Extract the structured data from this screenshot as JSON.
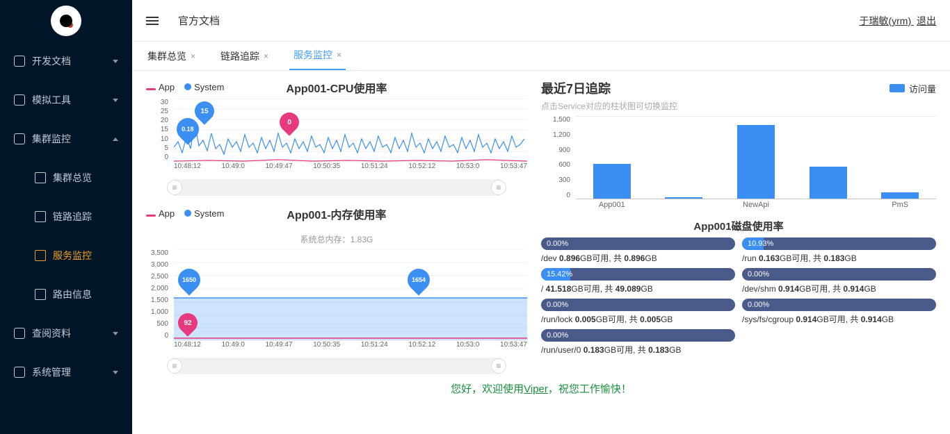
{
  "sidebar": {
    "items": [
      {
        "label": "开发文档",
        "chev": "down"
      },
      {
        "label": "模拟工具",
        "chev": "down"
      },
      {
        "label": "集群监控",
        "chev": "up"
      },
      {
        "label": "集群总览",
        "child": true
      },
      {
        "label": "链路追踪",
        "child": true
      },
      {
        "label": "服务监控",
        "child": true,
        "active": true
      },
      {
        "label": "路由信息",
        "child": true
      },
      {
        "label": "查阅资料",
        "chev": "down"
      },
      {
        "label": "系统管理",
        "chev": "down"
      }
    ]
  },
  "header": {
    "breadcrumb": "官方文档",
    "user": "于瑞敏(yrm) ",
    "logout": "退出"
  },
  "tabs": [
    {
      "label": "集群总览"
    },
    {
      "label": "链路追踪"
    },
    {
      "label": "服务监控",
      "active": true
    }
  ],
  "legend": {
    "app": "App",
    "system": "System"
  },
  "cpu": {
    "title": "App001-CPU使用率",
    "pin_app": "0",
    "pin_app_x": 192,
    "pin_app_y": 20,
    "pin_sys": "15",
    "pin_sys_x": 70,
    "pin_sys_y": 4,
    "pin_sys2": "0.18",
    "pin_sys2_x": 44,
    "pin_sys2_y": 28
  },
  "mem": {
    "title": "App001-内存使用率",
    "sub": "系统总内存：1.83G",
    "pin_app": "92",
    "pin_app_x": 46,
    "pin_app_y": 92,
    "pin_sys": "1650",
    "pin_sys_x": 46,
    "pin_sys_y": 28,
    "pin_sys2": "1654",
    "pin_sys2_x": 376,
    "pin_sys2_y": 28
  },
  "xticks": [
    "10:48:12",
    "10:49:0",
    "10:49:47",
    "10:50:35",
    "10:51:24",
    "10:52:12",
    "10:53:0",
    "10:53:47"
  ],
  "cpu_y": [
    "30",
    "25",
    "20",
    "15",
    "10",
    "5",
    "0"
  ],
  "mem_y": [
    "3,500",
    "3,000",
    "2,500",
    "2,000",
    "1,500",
    "1,000",
    "500",
    "0"
  ],
  "track": {
    "title": "最近7日追踪",
    "sub": "点击Service对应的柱状图可切换监控",
    "legend": "访问量",
    "y": [
      "1,500",
      "1,200",
      "900",
      "600",
      "300",
      "0"
    ]
  },
  "disk": {
    "title": "App001磁盘使用率",
    "rows": [
      {
        "pct": "0.00%",
        "w": 0,
        "text": "/dev <b>0.896</b>GB可用, 共 <b>0.896</b>GB"
      },
      {
        "pct": "10.93%",
        "w": 11,
        "text": "/run <b>0.163</b>GB可用, 共 <b>0.183</b>GB"
      },
      {
        "pct": "15.42%",
        "w": 15,
        "text": "/ <b>41.518</b>GB可用, 共 <b>49.089</b>GB"
      },
      {
        "pct": "0.00%",
        "w": 0,
        "text": "/dev/shm <b>0.914</b>GB可用, 共 <b>0.914</b>GB"
      },
      {
        "pct": "0.00%",
        "w": 0,
        "text": "/run/lock <b>0.005</b>GB可用, 共 <b>0.005</b>GB"
      },
      {
        "pct": "0.00%",
        "w": 0,
        "text": "/sys/fs/cgroup <b>0.914</b>GB可用, 共 <b>0.914</b>GB"
      },
      {
        "pct": "0.00%",
        "w": 0,
        "text": "/run/user/0 <b>0.183</b>GB可用, 共 <b>0.183</b>GB"
      }
    ]
  },
  "footer": {
    "pre": "您好，欢迎使用",
    "link": "Viper",
    "post": "，祝您工作愉快！"
  },
  "chart_data": [
    {
      "type": "line",
      "title": "App001-CPU使用率",
      "series": [
        {
          "name": "App",
          "sample_markers": [
            {
              "x": "10:49:47",
              "y": 0
            },
            {
              "x": "10:48:12",
              "y": 0.18
            }
          ]
        },
        {
          "name": "System",
          "sample_markers": [
            {
              "x": "10:48:40",
              "y": 15
            }
          ]
        }
      ],
      "x_range": [
        "10:48:12",
        "10:53:47"
      ],
      "ylim": [
        0,
        30
      ]
    },
    {
      "type": "line",
      "title": "App001-内存使用率",
      "subtitle": "系统总内存：1.83G",
      "series": [
        {
          "name": "App",
          "sample_markers": [
            {
              "x": "10:48:12",
              "y": 92
            }
          ]
        },
        {
          "name": "System",
          "sample_markers": [
            {
              "x": "10:48:12",
              "y": 1650
            },
            {
              "x": "10:52:12",
              "y": 1654
            }
          ]
        }
      ],
      "x_range": [
        "10:48:12",
        "10:53:47"
      ],
      "ylim": [
        0,
        3500
      ]
    },
    {
      "type": "bar",
      "title": "最近7日追踪",
      "legend": [
        "访问量"
      ],
      "categories": [
        "App001",
        "",
        "NewApi",
        "",
        "PmS"
      ],
      "values": [
        630,
        30,
        1350,
        580,
        120
      ],
      "ylim": [
        0,
        1500
      ]
    }
  ]
}
